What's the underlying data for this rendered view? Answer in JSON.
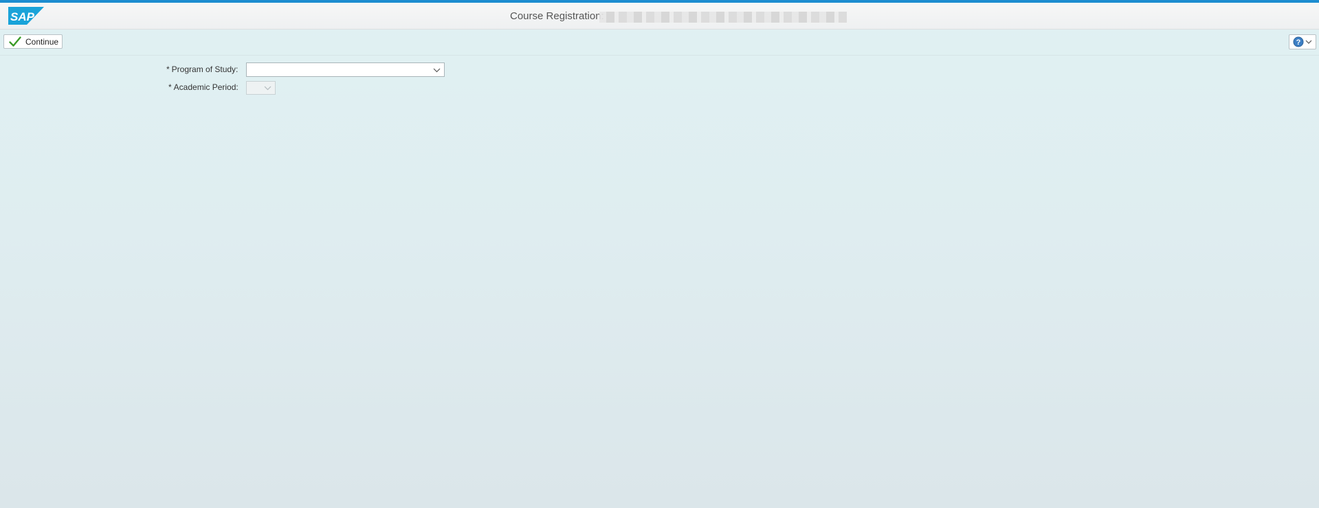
{
  "header": {
    "logo_text": "SAP",
    "title": "Course Registration:"
  },
  "toolbar": {
    "continue_label": "Continue",
    "help_icon": "help-icon"
  },
  "form": {
    "program_of_study": {
      "required_marker": "*",
      "label": "Program of Study:",
      "value": ""
    },
    "academic_period": {
      "required_marker": "*",
      "label": "Academic Period:",
      "value": "",
      "disabled": true
    }
  },
  "colors": {
    "accent": "#1d8dd0",
    "sap_logo": "#1aa3d9",
    "check_green": "#3b9b27"
  }
}
